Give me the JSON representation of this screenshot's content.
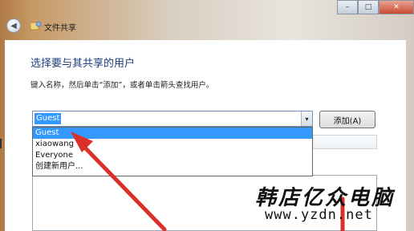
{
  "window": {
    "title": "文件共享",
    "controls": {
      "minimize": "–",
      "maximize": "□",
      "close": "✕"
    }
  },
  "page": {
    "heading": "选择要与其共享的用户",
    "instruction": "键入名称，然后单击“添加”，或者单击箭头查找用户。"
  },
  "combo": {
    "value": "Guest",
    "arrow": "▾"
  },
  "add_button": {
    "label": "添加(A)"
  },
  "dropdown": {
    "options": [
      "Guest",
      "xiaowang",
      "Everyone",
      "创建新用户..."
    ],
    "selected_index": 0
  },
  "watermark": {
    "text": "韩店亿众电脑",
    "url": "www.yzdn.net"
  },
  "colors": {
    "heading": "#1e3d7b",
    "selection": "#3399ff",
    "arrow": "#d9302a"
  }
}
